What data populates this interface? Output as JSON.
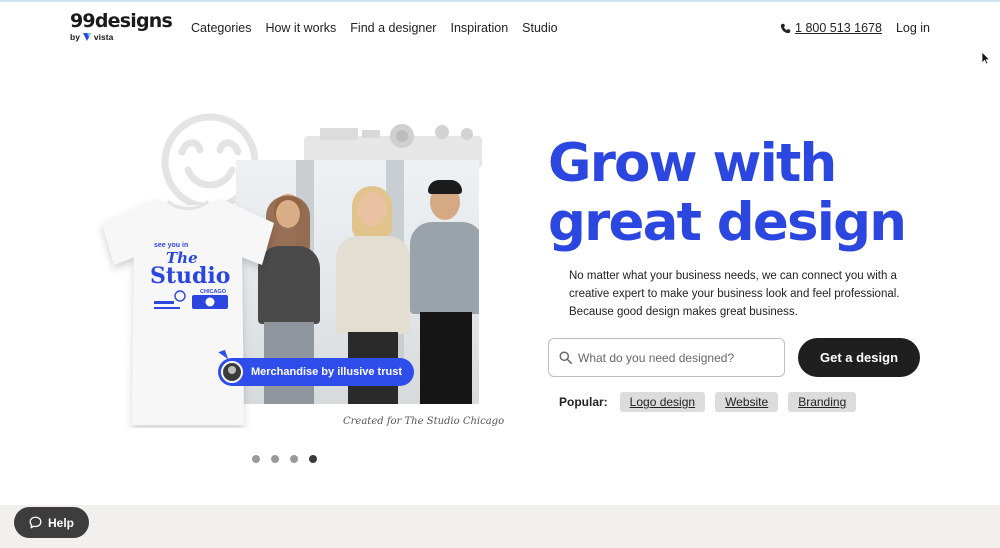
{
  "brand": {
    "name": "99designs",
    "byline": "by",
    "parent": "vista"
  },
  "nav": [
    "Categories",
    "How it works",
    "Find a designer",
    "Inspiration",
    "Studio"
  ],
  "header": {
    "phone": "1 800 513 1678",
    "login": "Log in"
  },
  "hero": {
    "headline_line1": "Grow with",
    "headline_line2": "great design",
    "subtext": "No matter what your business needs, we can connect you with a creative expert to make your business look and feel professional. Because good design makes great business.",
    "search_placeholder": "What do you need designed?",
    "cta": "Get a design",
    "popular_label": "Popular:",
    "popular": [
      "Logo design",
      "Website",
      "Branding"
    ]
  },
  "collage": {
    "badge": "Merchandise by illusive trust",
    "caption": "Created for The Studio Chicago",
    "shirt_line1": "see   you   in",
    "shirt_line2": "The",
    "shirt_line3": "Studio",
    "shirt_line4": "CHICAGO",
    "carousel_count": 4,
    "carousel_active": 4
  },
  "help": {
    "label": "Help"
  },
  "colors": {
    "brand_blue": "#2c46e0",
    "cta_dark": "#1f1f1f",
    "chip": "#dcdcdc",
    "band": "#f2f0ef"
  },
  "icons": {
    "phone": "phone-icon",
    "search": "search-icon",
    "help": "chat-bubble-icon"
  }
}
